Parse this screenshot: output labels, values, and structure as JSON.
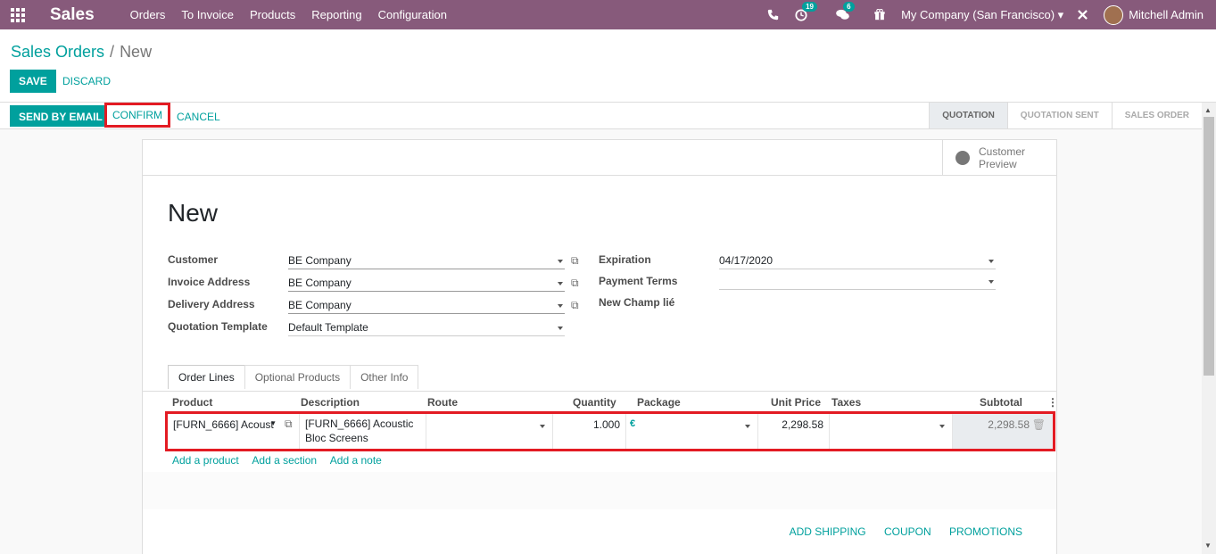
{
  "topbar": {
    "brand": "Sales",
    "menu": [
      "Orders",
      "To Invoice",
      "Products",
      "Reporting",
      "Configuration"
    ],
    "activities_count": "19",
    "messages_count": "6",
    "company": "My Company (San Francisco)",
    "user": "Mitchell Admin"
  },
  "breadcrumb": {
    "parent": "Sales Orders",
    "current": "New"
  },
  "actions": {
    "save": "SAVE",
    "discard": "DISCARD"
  },
  "statusbar": {
    "send_email": "SEND BY EMAIL",
    "confirm": "CONFIRM",
    "cancel": "CANCEL",
    "stages": [
      "QUOTATION",
      "QUOTATION SENT",
      "SALES ORDER"
    ],
    "active_stage": "QUOTATION"
  },
  "sheet": {
    "preview_line1": "Customer",
    "preview_line2": "Preview",
    "title": "New",
    "fields_left": [
      {
        "label": "Customer",
        "value": "BE Company"
      },
      {
        "label": "Invoice Address",
        "value": "BE Company"
      },
      {
        "label": "Delivery Address",
        "value": "BE Company"
      },
      {
        "label": "Quotation Template",
        "value": "Default Template"
      }
    ],
    "fields_right": [
      {
        "label": "Expiration",
        "value": "04/17/2020"
      },
      {
        "label": "Payment Terms",
        "value": ""
      },
      {
        "label": "New Champ lié",
        "value": ""
      }
    ],
    "tabs": [
      "Order Lines",
      "Optional Products",
      "Other Info"
    ],
    "columns": [
      "Product",
      "Description",
      "Route",
      "Quantity",
      "Package",
      "Unit Price",
      "Taxes",
      "Subtotal"
    ],
    "line": {
      "product": "[FURN_6666] Acoust",
      "description_1": "[FURN_6666] Acoustic",
      "description_2": "Bloc Screens",
      "route": "",
      "quantity": "1.000",
      "package": "",
      "unit_price": "2,298.58",
      "taxes": "",
      "subtotal": "2,298.58"
    },
    "add_links": [
      "Add a product",
      "Add a section",
      "Add a note"
    ],
    "footer_links": [
      "ADD SHIPPING",
      "COUPON",
      "PROMOTIONS"
    ]
  },
  "colors": {
    "brand": "#875a7b",
    "accent": "#00a09d",
    "highlight": "#e31b23"
  }
}
